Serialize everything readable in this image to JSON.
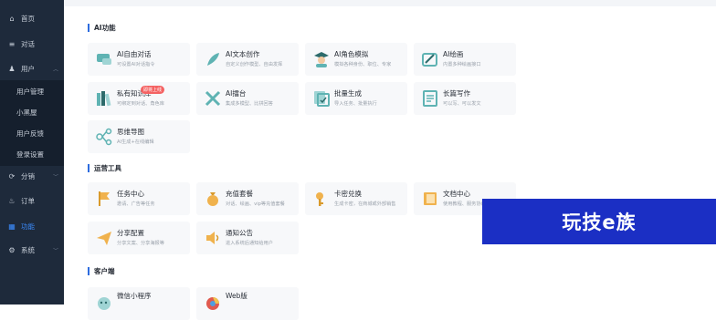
{
  "sidebar": {
    "items": [
      {
        "label": "首页",
        "icon": "home-icon",
        "glyph": "⌂"
      },
      {
        "label": "对话",
        "icon": "chat-icon",
        "glyph": "≡"
      },
      {
        "label": "用户",
        "icon": "user-icon",
        "glyph": "♟"
      },
      {
        "label": "分销",
        "icon": "share-icon",
        "glyph": "⟳"
      },
      {
        "label": "订单",
        "icon": "order-icon",
        "glyph": "♨"
      },
      {
        "label": "功能",
        "icon": "grid-icon",
        "glyph": "▦"
      },
      {
        "label": "系统",
        "icon": "settings-icon",
        "glyph": "⚙"
      }
    ],
    "sub_items": [
      "用户管理",
      "小黑屋",
      "用户反馈",
      "登录设置"
    ],
    "active_color": "#3b8cff"
  },
  "sections": [
    {
      "title": "AI功能",
      "cards": [
        {
          "title": "AI自由对话",
          "desc": "可设置AI对话指令",
          "icon": "chat-bubble-icon",
          "color": "#5fb3b3"
        },
        {
          "title": "AI文本创作",
          "desc": "自定义创作模型、自由发挥",
          "icon": "feather-icon",
          "color": "#5fb3b3"
        },
        {
          "title": "AI角色模拟",
          "desc": "模拟各种身份、职位、专家",
          "icon": "avatar-icon",
          "color": "#2d6b6b"
        },
        {
          "title": "AI绘画",
          "desc": "内置多种绘画接口",
          "icon": "drawing-icon",
          "color": "#5fb3b3"
        },
        {
          "title": "私有知识库",
          "desc": "可绑定到对话、角色库",
          "icon": "books-icon",
          "color": "#5fb3b3",
          "badge": "即将上线"
        },
        {
          "title": "AI擂台",
          "desc": "集成多模型、比拼回答",
          "icon": "swords-icon",
          "color": "#5fb3b3"
        },
        {
          "title": "批量生成",
          "desc": "导入任务、批量执行",
          "icon": "batch-icon",
          "color": "#5fb3b3"
        },
        {
          "title": "长篇写作",
          "desc": "可以写、可以发文",
          "icon": "document-icon",
          "color": "#5fb3b3"
        },
        {
          "title": "思维导图",
          "desc": "AI生成+在线编辑",
          "icon": "mindmap-icon",
          "color": "#5fb3b3"
        }
      ]
    },
    {
      "title": "运营工具",
      "cards": [
        {
          "title": "任务中心",
          "desc": "邀请、广告等任务",
          "icon": "flag-icon",
          "color": "#f0b24d"
        },
        {
          "title": "充值套餐",
          "desc": "对话、绘画、vip等充值套餐",
          "icon": "money-bag-icon",
          "color": "#f0b24d"
        },
        {
          "title": "卡密兑换",
          "desc": "生成卡密，在商城或外部销售",
          "icon": "key-icon",
          "color": "#f0b24d"
        },
        {
          "title": "文档中心",
          "desc": "使用教程、服务协议",
          "icon": "book-icon",
          "color": "#f0b24d"
        },
        {
          "title": "分享配置",
          "desc": "分享文案、分享海报等",
          "icon": "paper-plane-icon",
          "color": "#f0b24d"
        },
        {
          "title": "通知公告",
          "desc": "进入系统后通知给用户",
          "icon": "speaker-icon",
          "color": "#f0b24d"
        }
      ]
    },
    {
      "title": "客户端",
      "cards": [
        {
          "title": "微信小程序",
          "desc": "",
          "icon": "wechat-icon",
          "color": "#5fb3b3"
        },
        {
          "title": "Web版",
          "desc": "",
          "icon": "web-icon",
          "color": "#e05a4f"
        }
      ]
    }
  ],
  "watermark": {
    "text": "玩技e族",
    "color": "#1b2fc4"
  }
}
